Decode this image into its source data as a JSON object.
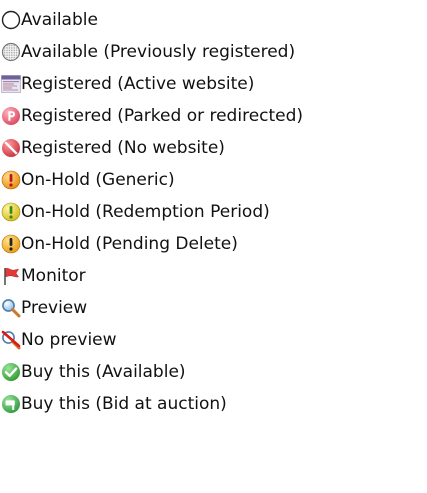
{
  "legend": {
    "items": [
      {
        "key": "available",
        "label": "Available",
        "icon": "empty-circle-icon"
      },
      {
        "key": "available-prev",
        "label": "Available (Previously registered)",
        "icon": "dotted-circle-icon"
      },
      {
        "key": "registered-active",
        "label": "Registered (Active website)",
        "icon": "website-thumbnail-icon"
      },
      {
        "key": "registered-parked",
        "label": "Registered (Parked or redirected)",
        "icon": "parked-p-icon"
      },
      {
        "key": "registered-none",
        "label": "Registered (No website)",
        "icon": "no-website-icon"
      },
      {
        "key": "onhold-generic",
        "label": "On-Hold (Generic)",
        "icon": "onhold-generic-icon"
      },
      {
        "key": "onhold-redemption",
        "label": "On-Hold (Redemption Period)",
        "icon": "onhold-redemption-icon"
      },
      {
        "key": "onhold-pending",
        "label": "On-Hold (Pending Delete)",
        "icon": "onhold-pending-icon"
      },
      {
        "key": "monitor",
        "label": "Monitor",
        "icon": "red-flag-icon"
      },
      {
        "key": "preview",
        "label": "Preview",
        "icon": "magnifier-icon"
      },
      {
        "key": "no-preview",
        "label": "No preview",
        "icon": "no-preview-icon"
      },
      {
        "key": "buy-available",
        "label": "Buy this (Available)",
        "icon": "green-check-icon"
      },
      {
        "key": "buy-auction",
        "label": "Buy this (Bid at auction)",
        "icon": "auction-gavel-icon"
      }
    ]
  },
  "colors": {
    "text": "#111111",
    "parked": "#e8657a",
    "no_website": "#e0505a",
    "onhold_generic": "#f2a21a",
    "onhold_redemption": "#e8d22a",
    "onhold_pending": "#f2b21a",
    "flag": "#e23a3a",
    "check": "#3ab23a",
    "auction": "#3aa24a"
  }
}
